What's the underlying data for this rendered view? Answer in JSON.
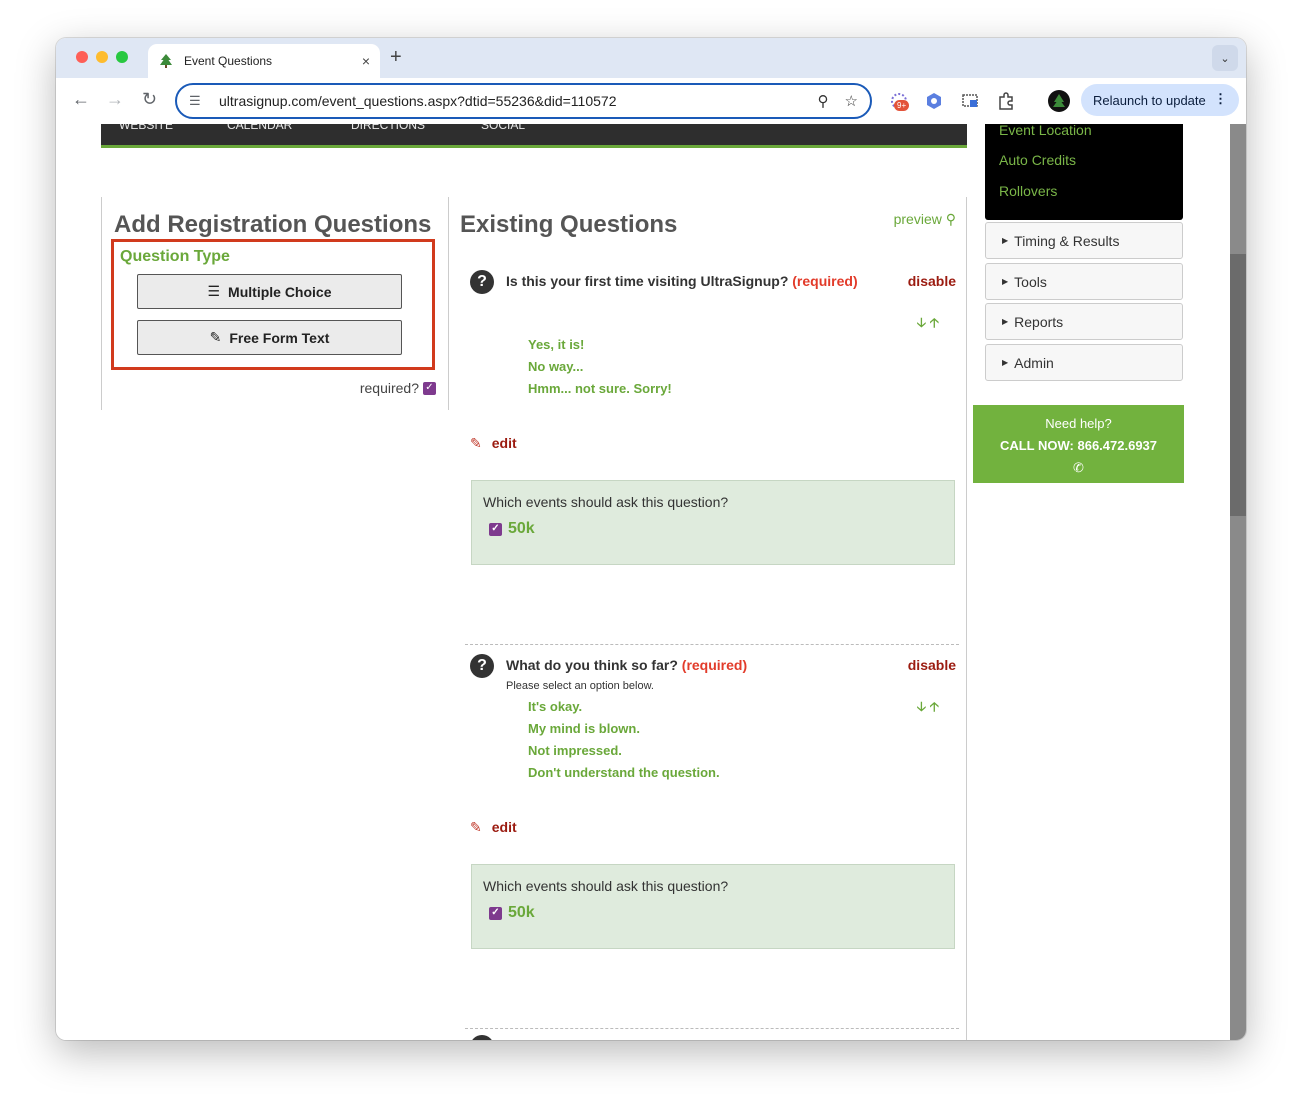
{
  "browser": {
    "tab_title": "Event Questions",
    "tab_close": "×",
    "new_tab": "+",
    "url": "ultrasignup.com/event_questions.aspx?dtid=55236&did=110572",
    "ext_badge": "9+",
    "relaunch_label": "Relaunch to update"
  },
  "topnav": {
    "items": [
      "WEBSITE",
      "CALENDAR",
      "DIRECTIONS",
      "SOCIAL"
    ]
  },
  "sidebar": {
    "links": [
      "Event Location",
      "Auto Credits",
      "Rollovers"
    ],
    "accordions": [
      "Timing & Results",
      "Tools",
      "Reports",
      "Admin"
    ],
    "help": {
      "line1": "Need help?",
      "line2": "CALL NOW: 866.472.6937",
      "icon": "phone-icon"
    }
  },
  "add_panel": {
    "title": "Add Registration Questions",
    "question_type_label": "Question Type",
    "multiple_choice_label": "Multiple Choice",
    "free_form_label": "Free Form Text",
    "required_label": "required?",
    "required_checked": true,
    "highlight_color": "#d13a1d"
  },
  "existing": {
    "title": "Existing Questions",
    "preview_label": "preview",
    "questions": [
      {
        "text": "Is this your first time visiting UltraSignup?",
        "required_tag": "(required)",
        "disable_label": "disable",
        "subtext": "",
        "options": [
          "Yes, it is!",
          "No way...",
          "Hmm... not sure. Sorry!"
        ],
        "edit_label": "edit",
        "events_prompt": "Which events should ask this question?",
        "events": [
          {
            "label": "50k",
            "checked": true
          }
        ]
      },
      {
        "text": "What do you think so far?",
        "required_tag": "(required)",
        "disable_label": "disable",
        "subtext": "Please select an option below.",
        "options": [
          "It's okay.",
          "My mind is blown.",
          "Not impressed.",
          "Don't understand the question."
        ],
        "edit_label": "edit",
        "events_prompt": "Which events should ask this question?",
        "events": [
          {
            "label": "50k",
            "checked": true
          }
        ]
      }
    ]
  },
  "colors": {
    "brand_green": "#6aa83a",
    "required_red": "#e23b2a",
    "disable_red": "#9b1b10",
    "checkbox_purple": "#7e3a8e"
  }
}
